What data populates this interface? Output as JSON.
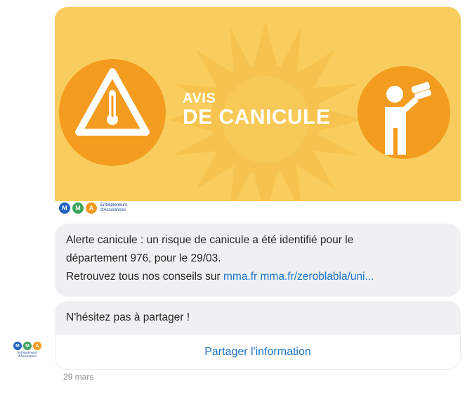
{
  "banner": {
    "line1": "AVIS",
    "line2": "DE CANICULE",
    "bg_color": "#f8cd5d",
    "left_icon": "heat-warning-thermometer-icon",
    "right_icon": "person-binoculars-icon"
  },
  "brand": {
    "logo_letters": [
      "M",
      "M",
      "A"
    ],
    "logo_colors": [
      "#1f5fbf",
      "#3aa35c",
      "#f39a1e"
    ],
    "name_line1": "Entrepreneurs",
    "name_line2": "d'Assurances"
  },
  "message": {
    "text_line1": "Alerte canicule : un risque de canicule a été identifié pour le",
    "text_line2": "département 976, pour le 29/03.",
    "text_line3_prefix": "Retrouvez tous nos conseils sur ",
    "link1": "mma.fr",
    "link2": "mma.fr/zeroblabla/uni..."
  },
  "share": {
    "prompt": "N'hésitez pas à partager !",
    "button_label": "Partager l'information"
  },
  "timestamp": "29 mars",
  "colors": {
    "link": "#1a73c9",
    "bubble_bg": "#eff0f2"
  }
}
